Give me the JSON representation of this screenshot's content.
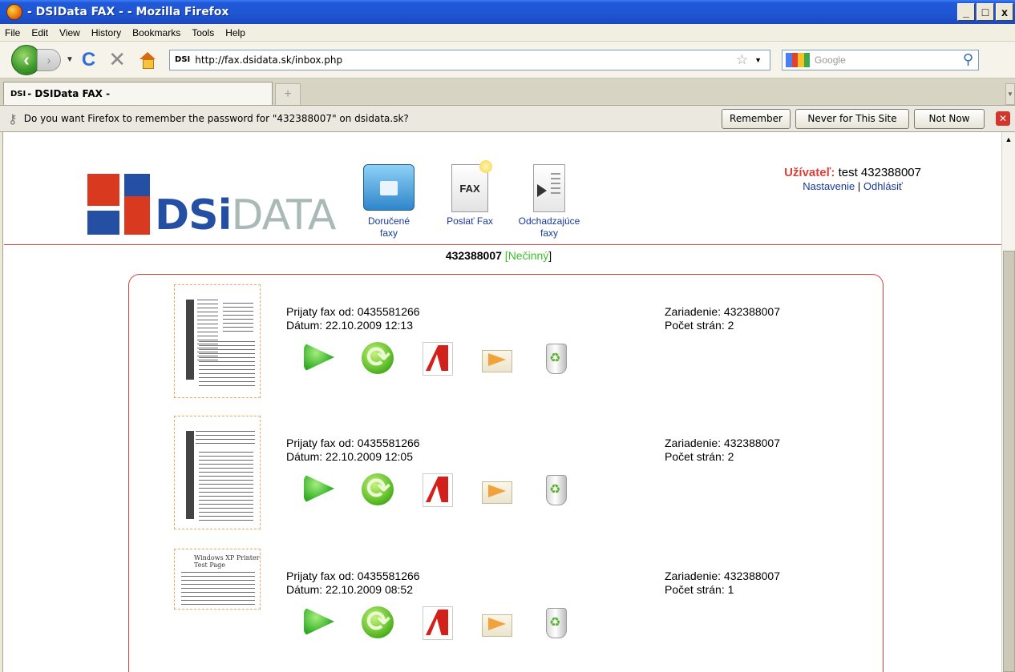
{
  "window": {
    "title": "- DSIData FAX - - Mozilla Firefox",
    "minimize": "_",
    "maximize": "□",
    "close": "x"
  },
  "menu": [
    "File",
    "Edit",
    "View",
    "History",
    "Bookmarks",
    "Tools",
    "Help"
  ],
  "nav": {
    "favicon_text": "DSI",
    "url": "http://fax.dsidata.sk/inbox.php",
    "search_placeholder": "Google"
  },
  "tabs": [
    {
      "favicon_text": "DSI",
      "label": "- DSIData FAX -"
    }
  ],
  "password_bar": {
    "message": "Do you want Firefox to remember the password for \"432388007\" on dsidata.sk?",
    "remember_label": "Remember",
    "never_label": "Never for This Site",
    "notnow_label": "Not Now"
  },
  "site": {
    "logo_bold": "DSi",
    "logo_light": "DATA",
    "nav": [
      {
        "label": "Doručené faxy"
      },
      {
        "label": "Poslať Fax"
      },
      {
        "label": "Odchadzajúce faxy"
      }
    ],
    "fax_icon_text": "FAX",
    "user": {
      "label": "Užívateľ:",
      "value": "test 432388007",
      "settings": "Nastavenie",
      "separator": "|",
      "logout": "Odhlásiť"
    },
    "status": {
      "number": "432388007",
      "open": "[",
      "state": "Nečinný",
      "close": "]"
    }
  },
  "faxes": [
    {
      "from": "Prijaty fax od: 0435581266",
      "date": "Dátum: 22.10.2009 12:13",
      "device": "Zariadenie: 432388007",
      "pages": "Počet strán: 2"
    },
    {
      "from": "Prijaty fax od: 0435581266",
      "date": "Dátum: 22.10.2009 12:05",
      "device": "Zariadenie: 432388007",
      "pages": "Počet strán: 2"
    },
    {
      "from": "Prijaty fax od: 0435581266",
      "date": "Dátum: 22.10.2009 08:52",
      "device": "Zariadenie: 432388007",
      "pages": "Počet strán: 1",
      "thumb_title": "Windows XP Printer Test Page"
    }
  ],
  "colors": {
    "accent_red": "#d9403a",
    "link_blue": "#173a9a",
    "status_green": "#3cbf2a",
    "thumb_border": "#f5a560"
  }
}
